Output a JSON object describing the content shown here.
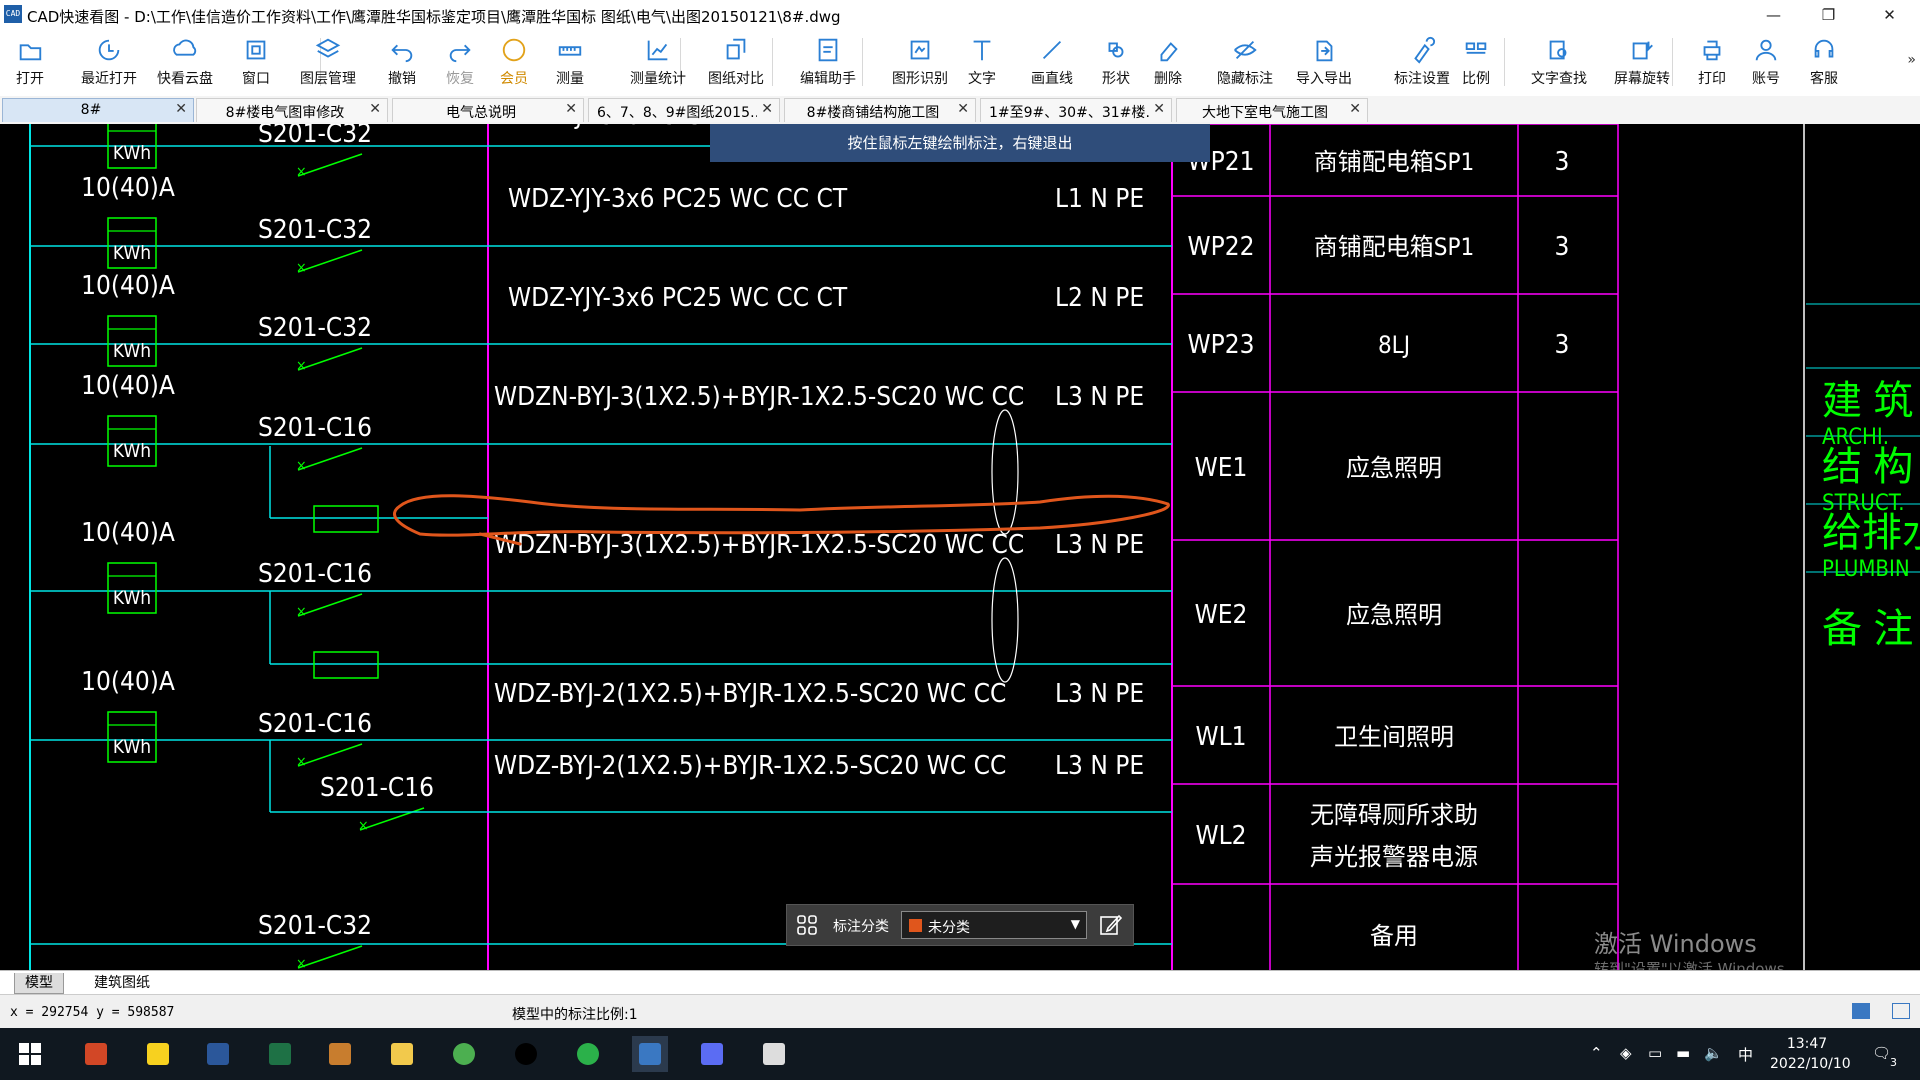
{
  "window": {
    "title": "CAD快速看图 - D:\\工作\\佳信造价工作资料\\工作\\鹰潭胜华国标鉴定项目\\鹰潭胜华国标 图纸\\电气\\出图20150121\\8#.dwg",
    "logo_text": "CAD",
    "minimize": "—",
    "maximize": "❐",
    "close": "✕"
  },
  "toolbar": {
    "items": [
      {
        "label": "打开",
        "icon": "folder-open-icon"
      },
      {
        "label": "最近打开",
        "icon": "recent-icon"
      },
      {
        "label": "快看云盘",
        "icon": "cloud-icon"
      },
      {
        "label": "窗口",
        "icon": "window-icon"
      },
      {
        "label": "图层管理",
        "icon": "layers-icon"
      },
      {
        "label": "撤销",
        "icon": "undo-icon"
      },
      {
        "label": "恢复",
        "icon": "redo-icon"
      },
      {
        "label": "会员",
        "icon": "vip-icon"
      },
      {
        "label": "测量",
        "icon": "measure-icon"
      },
      {
        "label": "测量统计",
        "icon": "measure-stats-icon"
      },
      {
        "label": "图纸对比",
        "icon": "compare-icon"
      },
      {
        "label": "编辑助手",
        "icon": "edit-assistant-icon"
      },
      {
        "label": "图形识别",
        "icon": "shape-recognize-icon"
      },
      {
        "label": "文字",
        "icon": "text-icon"
      },
      {
        "label": "画直线",
        "icon": "line-icon"
      },
      {
        "label": "形状",
        "icon": "shape-icon"
      },
      {
        "label": "删除",
        "icon": "eraser-icon"
      },
      {
        "label": "隐藏标注",
        "icon": "hide-annotation-icon"
      },
      {
        "label": "导入导出",
        "icon": "import-export-icon"
      },
      {
        "label": "标注设置",
        "icon": "annotation-settings-icon"
      },
      {
        "label": "比例",
        "icon": "scale-icon"
      },
      {
        "label": "文字查找",
        "icon": "text-search-icon"
      },
      {
        "label": "屏幕旋转",
        "icon": "rotate-screen-icon"
      },
      {
        "label": "打印",
        "icon": "print-icon"
      },
      {
        "label": "账号",
        "icon": "account-icon"
      },
      {
        "label": "客服",
        "icon": "support-icon"
      }
    ],
    "more": "»"
  },
  "tabs": [
    {
      "label": "8#"
    },
    {
      "label": "8#楼电气图审修改"
    },
    {
      "label": "电气总说明"
    },
    {
      "label": "6、7、8、9#图纸2015…"
    },
    {
      "label": "8#楼商铺结构施工图"
    },
    {
      "label": "1#至9#、30#、31#楼…"
    },
    {
      "label": "大地下室电气施工图"
    }
  ],
  "tab_close": "✕",
  "hint": "按住鼠标左键绘制标注，右键退出",
  "drawing": {
    "meters": [
      {
        "rating": "",
        "kwh": "KWh"
      },
      {
        "rating": "10(40)A",
        "kwh": "KWh"
      },
      {
        "rating": "10(40)A",
        "kwh": "KWh"
      },
      {
        "rating": "10(40)A",
        "kwh": "KWh"
      },
      {
        "rating": "10(40)A",
        "kwh": "KWh"
      },
      {
        "rating": "10(40)A",
        "kwh": "KWh"
      }
    ],
    "breakers": [
      "S201-C32",
      "S201-C32",
      "S201-C32",
      "S201-C16",
      "S201-C16",
      "S201-C16",
      "S201-C16",
      "S201-C32"
    ],
    "top_partial_cable": "WDZ-YJY-3x6 PC25 WC CC CT",
    "cables": [
      "WDZ-YJY-3x6  PC25  WC CC CT",
      "WDZ-YJY-3x6  PC25  WC CC CT",
      "WDZN-BYJ-3(1X2.5)+BYJR-1X2.5-SC20 WC CC",
      "WDZN-BYJ-3(1X2.5)+BYJR-1X2.5-SC20 WC CC",
      "WDZ-BYJ-2(1X2.5)+BYJR-1X2.5-SC20 WC CC",
      "WDZ-BYJ-2(1X2.5)+BYJR-1X2.5-SC20 WC CC"
    ],
    "phases": [
      "L1 N PE",
      "L2 N PE",
      "L3 N PE",
      "L3 N PE",
      "L3 N PE",
      "L3 N PE"
    ],
    "circuits": [
      {
        "id": "WP21",
        "name": "商铺配电箱SP1",
        "qty": "3"
      },
      {
        "id": "WP22",
        "name": "商铺配电箱SP1",
        "qty": "3"
      },
      {
        "id": "WP23",
        "name": "8LJ",
        "qty": "3"
      },
      {
        "id": "WE1",
        "name": "应急照明",
        "qty": ""
      },
      {
        "id": "WE2",
        "name": "应急照明",
        "qty": ""
      },
      {
        "id": "WL1",
        "name": "卫生间照明",
        "qty": ""
      },
      {
        "id": "WL2",
        "name": "无障碍厕所求助\n声光报警器电源",
        "qty": ""
      },
      {
        "id": "",
        "name": "备用",
        "qty": ""
      }
    ],
    "title_block": [
      {
        "cn": "建 筑",
        "en": "ARCHI."
      },
      {
        "cn": "结 构",
        "en": "STRUCT."
      },
      {
        "cn": "给排水",
        "en": "PLUMBIN"
      },
      {
        "cn": "备 注",
        "en": ""
      }
    ],
    "line_color": "#00e5e5",
    "comp_color": "#00ff00",
    "border_color": "#ff00ff",
    "text_color": "#ffffff",
    "markup_color": "#e0561c"
  },
  "annotation_bar": {
    "label": "标注分类",
    "selected": "未分类"
  },
  "watermark": {
    "line1": "激活 Windows",
    "line2": "转到\"设置\"以激活 Windows。"
  },
  "layout_tabs": [
    "模型",
    "建筑图纸"
  ],
  "status": {
    "coords": "x = 292754  y = 598587",
    "scale": "模型中的标注比例:1"
  },
  "taskbar": {
    "apps": [
      "start-icon",
      "powerpoint-icon",
      "sticky-notes-icon",
      "word-icon",
      "excel-icon",
      "app-icon",
      "file-explorer-icon",
      "browser-icon",
      "qq-icon",
      "wechat-icon",
      "cad-viewer-icon",
      "arc-app-icon",
      "settings-icon"
    ],
    "ime": "中",
    "time": "13:47",
    "date": "2022/10/10",
    "notifications": "3"
  }
}
